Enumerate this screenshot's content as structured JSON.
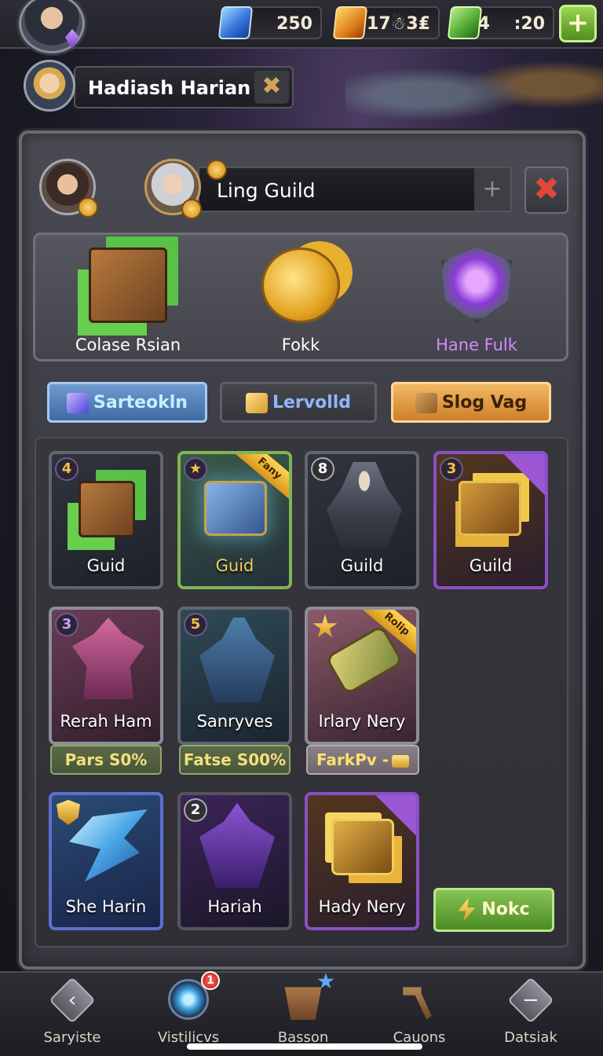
{
  "topbar": {
    "currencies": [
      {
        "icon": "blue-gem-icon",
        "value": "250",
        "color": "#2f6fd6"
      },
      {
        "icon": "gold-gem-icon",
        "value": "17☃3₤",
        "color": "#e07f1b"
      },
      {
        "icon": "green-gem-icon",
        "value": "4    :20",
        "color": "#4da630"
      }
    ],
    "add_label": "+"
  },
  "player": {
    "name": "Hadiash Harian",
    "close_label": "✖"
  },
  "guild": {
    "name": "Ling Guild",
    "add_label": "+",
    "close_label": "✖"
  },
  "rewards": [
    {
      "label": "Colase Rsian",
      "icon": "crate-icon"
    },
    {
      "label": "Fokk",
      "icon": "coins-icon"
    },
    {
      "label": "Hane Fulk",
      "icon": "purple-shield-icon",
      "color": "#d38bff"
    }
  ],
  "tabs": [
    {
      "label": "Sarteokln",
      "icon": "cube-icon",
      "active": true
    },
    {
      "label": "Lervolld",
      "icon": "gold-bar-icon",
      "active": false
    },
    {
      "label": "Slog Vag",
      "icon": "crate-icon",
      "active": false
    }
  ],
  "cards": [
    {
      "label": "Guid",
      "badge": "4"
    },
    {
      "label": "Guid",
      "badge": "★",
      "ribbon": "Fany"
    },
    {
      "label": "Guild",
      "badge": "8"
    },
    {
      "label": "Guild",
      "badge": "3"
    },
    {
      "label": "Rerah Ham",
      "badge": "3"
    },
    {
      "label": "Sanryves",
      "badge": "5"
    },
    {
      "label": "Irlary Nery",
      "ribbon": "Rolip"
    },
    {
      "label": "She Harin"
    },
    {
      "label": "Hariah",
      "badge": "2"
    },
    {
      "label": "Hady Nery"
    }
  ],
  "prices": [
    {
      "label": "Pars S0%"
    },
    {
      "label": "Fatse S00%"
    },
    {
      "label": "FarkPv -"
    }
  ],
  "confirm_label": "Nokc",
  "nav": [
    {
      "label": "Saryiste",
      "icon": "back-arrow-icon"
    },
    {
      "label": "Vistilicvs",
      "icon": "portal-icon",
      "notification": "1"
    },
    {
      "label": "Basson",
      "icon": "basket-icon"
    },
    {
      "label": "Cauons",
      "icon": "hammer-icon"
    },
    {
      "label": "Datsiak",
      "icon": "minus-icon"
    }
  ]
}
